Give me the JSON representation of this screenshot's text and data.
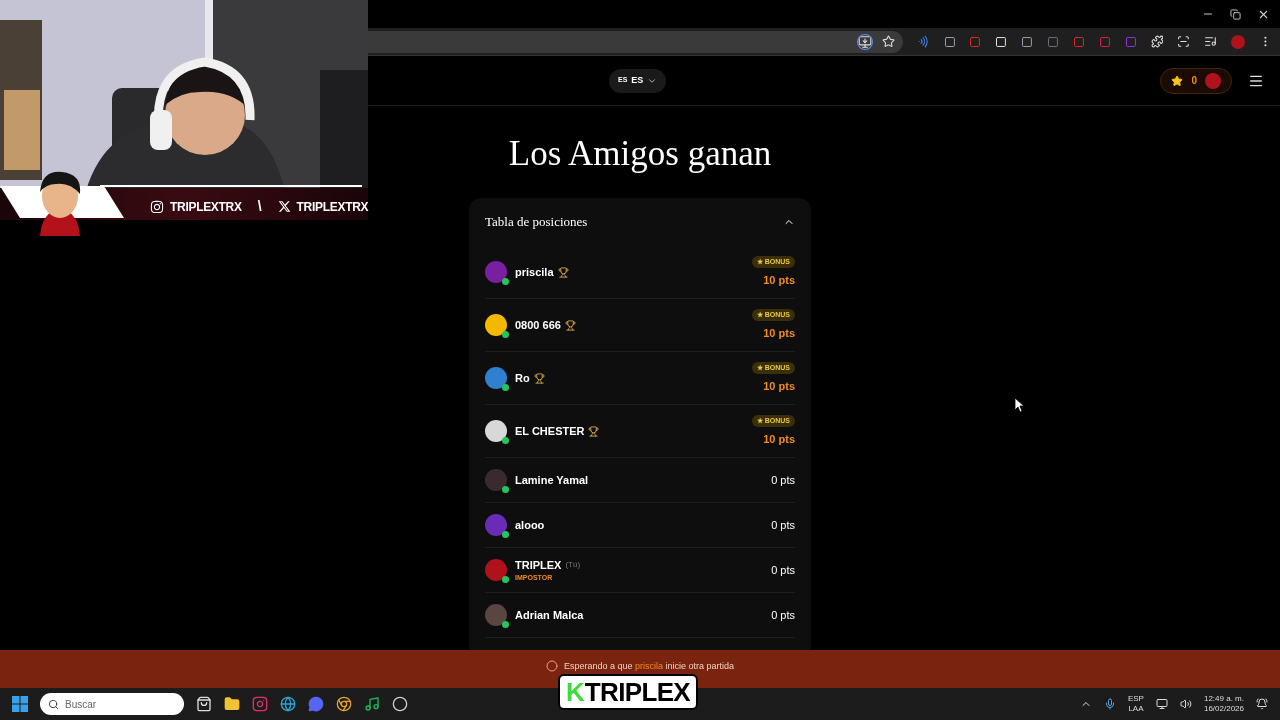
{
  "webcam": {
    "kind": "picture",
    "socials": [
      {
        "kind": "instagram",
        "handle": "TRIPLEXTRX"
      },
      {
        "kind": "x",
        "handle": "TRIPLEXTRX"
      }
    ],
    "separator": "\\"
  },
  "header": {
    "language": {
      "flag": "ES",
      "code": "ES"
    },
    "stars": "0"
  },
  "title": "Los Amigos ganan",
  "leaderboard": {
    "title": "Tabla de posiciones",
    "expanded": true,
    "players": [
      {
        "name": "priscila",
        "trophy": true,
        "online": true,
        "bonus": "★ BONUS",
        "points": "10 pts",
        "color": "#7b1fa2"
      },
      {
        "name": "0800 666",
        "trophy": true,
        "online": true,
        "bonus": "★ BONUS",
        "points": "10 pts",
        "color": "#f5b800"
      },
      {
        "name": "Ro",
        "trophy": true,
        "online": true,
        "bonus": "★ BONUS",
        "points": "10 pts",
        "color": "#2f80d0"
      },
      {
        "name": "EL CHESTER",
        "trophy": true,
        "online": true,
        "bonus": "★ BONUS",
        "points": "10 pts",
        "color": "#d8d8d8"
      },
      {
        "name": "Lamine Yamal",
        "trophy": false,
        "online": true,
        "points": "0 pts",
        "color": "#3a2a30"
      },
      {
        "name": "alooo",
        "trophy": false,
        "online": true,
        "points": "0 pts",
        "color": "#6a2bb8"
      },
      {
        "name": "TRIPLEX",
        "you": "(Tú)",
        "role": "IMPOSTOR",
        "trophy": false,
        "online": true,
        "points": "0 pts",
        "color": "#b0121c"
      },
      {
        "name": "Adrian Malca",
        "trophy": false,
        "online": true,
        "points": "0 pts",
        "color": "#5a4640"
      }
    ]
  },
  "banner": {
    "before": "Esperando a que",
    "name": "priscila",
    "after": "inicie otra partida"
  },
  "overlay_logo": {
    "mark": "K",
    "text": "TRIPLEX"
  },
  "taskbar": {
    "search": {
      "placeholder": "Buscar"
    },
    "language": [
      "ESP",
      "LAA"
    ],
    "time": "12:49 a. m.",
    "date": "16/02/2026"
  }
}
